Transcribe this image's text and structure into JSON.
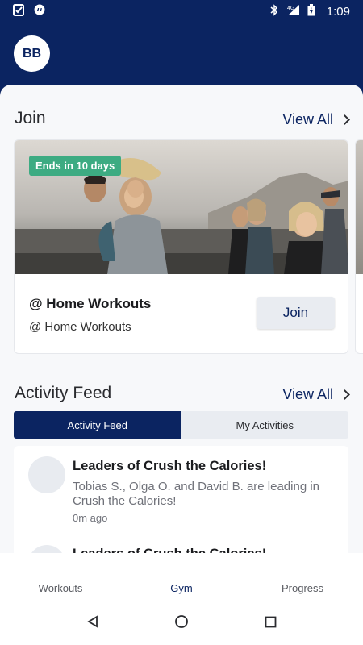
{
  "status_bar": {
    "time": "1:09",
    "network": "4G",
    "icons": [
      "task-check-icon",
      "quote-chat-icon",
      "bluetooth-icon",
      "signal-icon",
      "battery-icon"
    ]
  },
  "header": {
    "avatar_initials": "BB"
  },
  "join_section": {
    "title": "Join",
    "view_all": "View All",
    "card": {
      "badge": "Ends in 10 days",
      "title": "@ Home Workouts",
      "subtitle": "@ Home Workouts",
      "button": "Join"
    }
  },
  "activity_section": {
    "title": "Activity Feed",
    "view_all": "View All",
    "tabs": [
      {
        "label": "Activity Feed",
        "active": true
      },
      {
        "label": "My Activities",
        "active": false
      }
    ],
    "items": [
      {
        "title": "Leaders of Crush the Calories!",
        "body": "Tobias S., Olga O. and David B. are leading in Crush the Calories!",
        "time": "0m ago"
      },
      {
        "title": "Leaders of Crush the Calories!",
        "body": "",
        "time": ""
      }
    ]
  },
  "bottom_nav": {
    "items": [
      {
        "label": "Workouts",
        "active": false
      },
      {
        "label": "Gym",
        "active": true
      },
      {
        "label": "Progress",
        "active": false
      }
    ]
  },
  "colors": {
    "brand_navy": "#0b2461",
    "badge_green": "#3dab82",
    "sheet_bg": "#f7f8fa"
  }
}
